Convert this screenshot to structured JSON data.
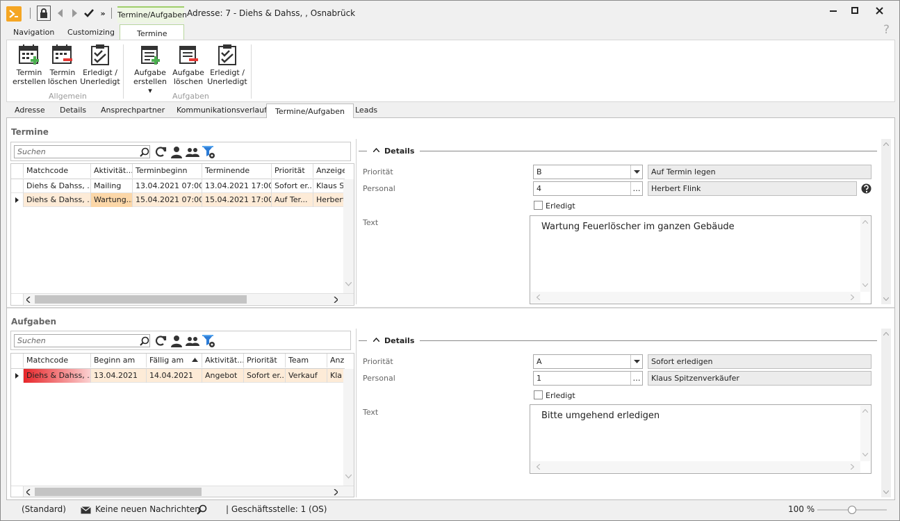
{
  "window": {
    "context_tab": "Termine/Aufgaben",
    "title": "Adresse: 7 - Diehs & Dahss, , Osnabrück",
    "help": "?",
    "minimize": "▬",
    "maximize": "□",
    "close": "✕"
  },
  "menu_tabs": [
    "Navigation",
    "Customizing",
    "Termine"
  ],
  "ribbon": {
    "groups": [
      {
        "label": "Allgemein",
        "buttons": [
          {
            "line1": "Termin",
            "line2": "erstellen",
            "icon": "calendar-add-icon"
          },
          {
            "line1": "Termin",
            "line2": "löschen",
            "icon": "calendar-delete-icon"
          },
          {
            "line1": "Erledigt /",
            "line2": "Unerledigt",
            "icon": "clipboard-check-icon"
          }
        ]
      },
      {
        "label": "Aufgaben",
        "buttons": [
          {
            "line1": "Aufgabe",
            "line2": "erstellen ▾",
            "icon": "task-add-icon"
          },
          {
            "line1": "Aufgabe",
            "line2": "löschen",
            "icon": "task-delete-icon"
          },
          {
            "line1": "Erledigt /",
            "line2": "Unerledigt",
            "icon": "clipboard-check-icon"
          }
        ]
      }
    ]
  },
  "record_tabs": [
    "Adresse",
    "Details",
    "Ansprechpartner",
    "Kommunikationsverlauf",
    "Termine/Aufgaben",
    "Leads"
  ],
  "termine": {
    "title": "Termine",
    "search_placeholder": "Suchen",
    "columns": [
      "Matchcode",
      "Aktivität...",
      "Terminbeginn",
      "Terminende",
      "Priorität",
      "Anzeige"
    ],
    "rows": [
      [
        "Diehs & Dahss, ...",
        "Mailing",
        "13.04.2021 07:00",
        "13.04.2021 17:00",
        "Sofort er...",
        "Klaus Sp"
      ],
      [
        "Diehs & Dahss, ...",
        "Wartung...",
        "15.04.2021 07:00",
        "15.04.2021 17:00",
        "Auf Ter...",
        "Herbert"
      ]
    ],
    "details": {
      "header": "Details",
      "prioritaet_label": "Priorität",
      "prioritaet_value": "B",
      "prioritaet_text": "Auf Termin legen",
      "personal_label": "Personal",
      "personal_value": "4",
      "personal_text": "Herbert Flink",
      "erledigt_label": "Erledigt",
      "text_label": "Text",
      "text_value": "Wartung Feuerlöscher im ganzen Gebäude"
    }
  },
  "aufgaben": {
    "title": "Aufgaben",
    "search_placeholder": "Suchen",
    "columns": [
      "Matchcode",
      "Beginn am",
      "Fällig am",
      "Aktivität...",
      "Priorität",
      "Team",
      "Anz"
    ],
    "rows": [
      [
        "Diehs & Dahss, ...",
        "13.04.2021",
        "14.04.2021",
        "Angebot",
        "Sofort er...",
        "Verkauf",
        "Kla"
      ]
    ],
    "details": {
      "header": "Details",
      "prioritaet_label": "Priorität",
      "prioritaet_value": "A",
      "prioritaet_text": "Sofort erledigen",
      "personal_label": "Personal",
      "personal_value": "1",
      "personal_text": "Klaus Spitzenverkäufer",
      "erledigt_label": "Erledigt",
      "text_label": "Text",
      "text_value": "Bitte umgehend erledigen"
    }
  },
  "status": {
    "layout": "(Standard)",
    "messages": "Keine neuen Nachrichten",
    "branch": "| Geschäftsstelle:  1 (OS)",
    "zoom": "100 %",
    "zoom_level": 0.5
  },
  "colors": {
    "accent_green": "#9fce6b",
    "selected_row": "#fdebd7",
    "highlight_cell": "#fcd7a8",
    "match_red": "#e8262a"
  }
}
